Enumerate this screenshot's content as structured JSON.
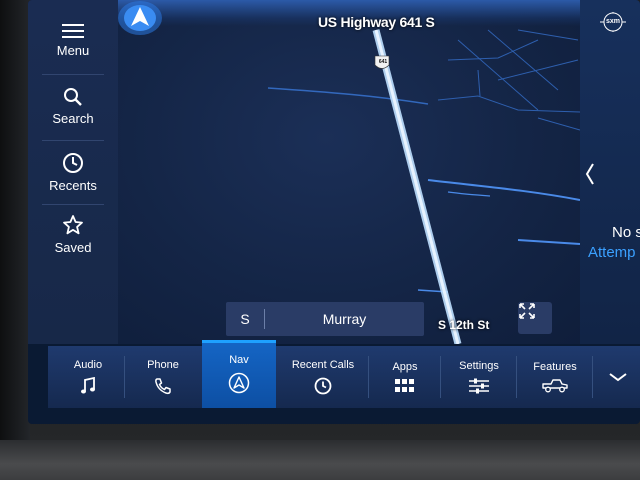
{
  "sidebar": {
    "items": [
      {
        "label": "Menu",
        "icon": "menu-icon"
      },
      {
        "label": "Search",
        "icon": "search-icon"
      },
      {
        "label": "Recents",
        "icon": "clock-icon"
      },
      {
        "label": "Saved",
        "icon": "star-icon"
      }
    ]
  },
  "map": {
    "road_title": "US Highway 641 S",
    "shield_number": "641",
    "current_direction": "S",
    "current_street": "Murray",
    "cross_street": "S 12th St"
  },
  "right_panel": {
    "logo": "sxm",
    "title": "No s",
    "subtitle": "Attemp"
  },
  "bottom_bar": {
    "tabs": [
      {
        "label": "Audio",
        "icon": "music-note-icon"
      },
      {
        "label": "Phone",
        "icon": "phone-icon"
      },
      {
        "label": "Nav",
        "icon": "nav-arrow-icon",
        "active": true
      },
      {
        "label": "Recent Calls",
        "icon": "clock-icon"
      },
      {
        "label": "Apps",
        "icon": "apps-grid-icon"
      },
      {
        "label": "Settings",
        "icon": "sliders-icon"
      },
      {
        "label": "Features",
        "icon": "truck-icon"
      }
    ]
  },
  "colors": {
    "accent": "#1ea1ff",
    "map_background": "#142546",
    "road_route": "#cfe3ff",
    "active_tab": "#1566c6"
  }
}
